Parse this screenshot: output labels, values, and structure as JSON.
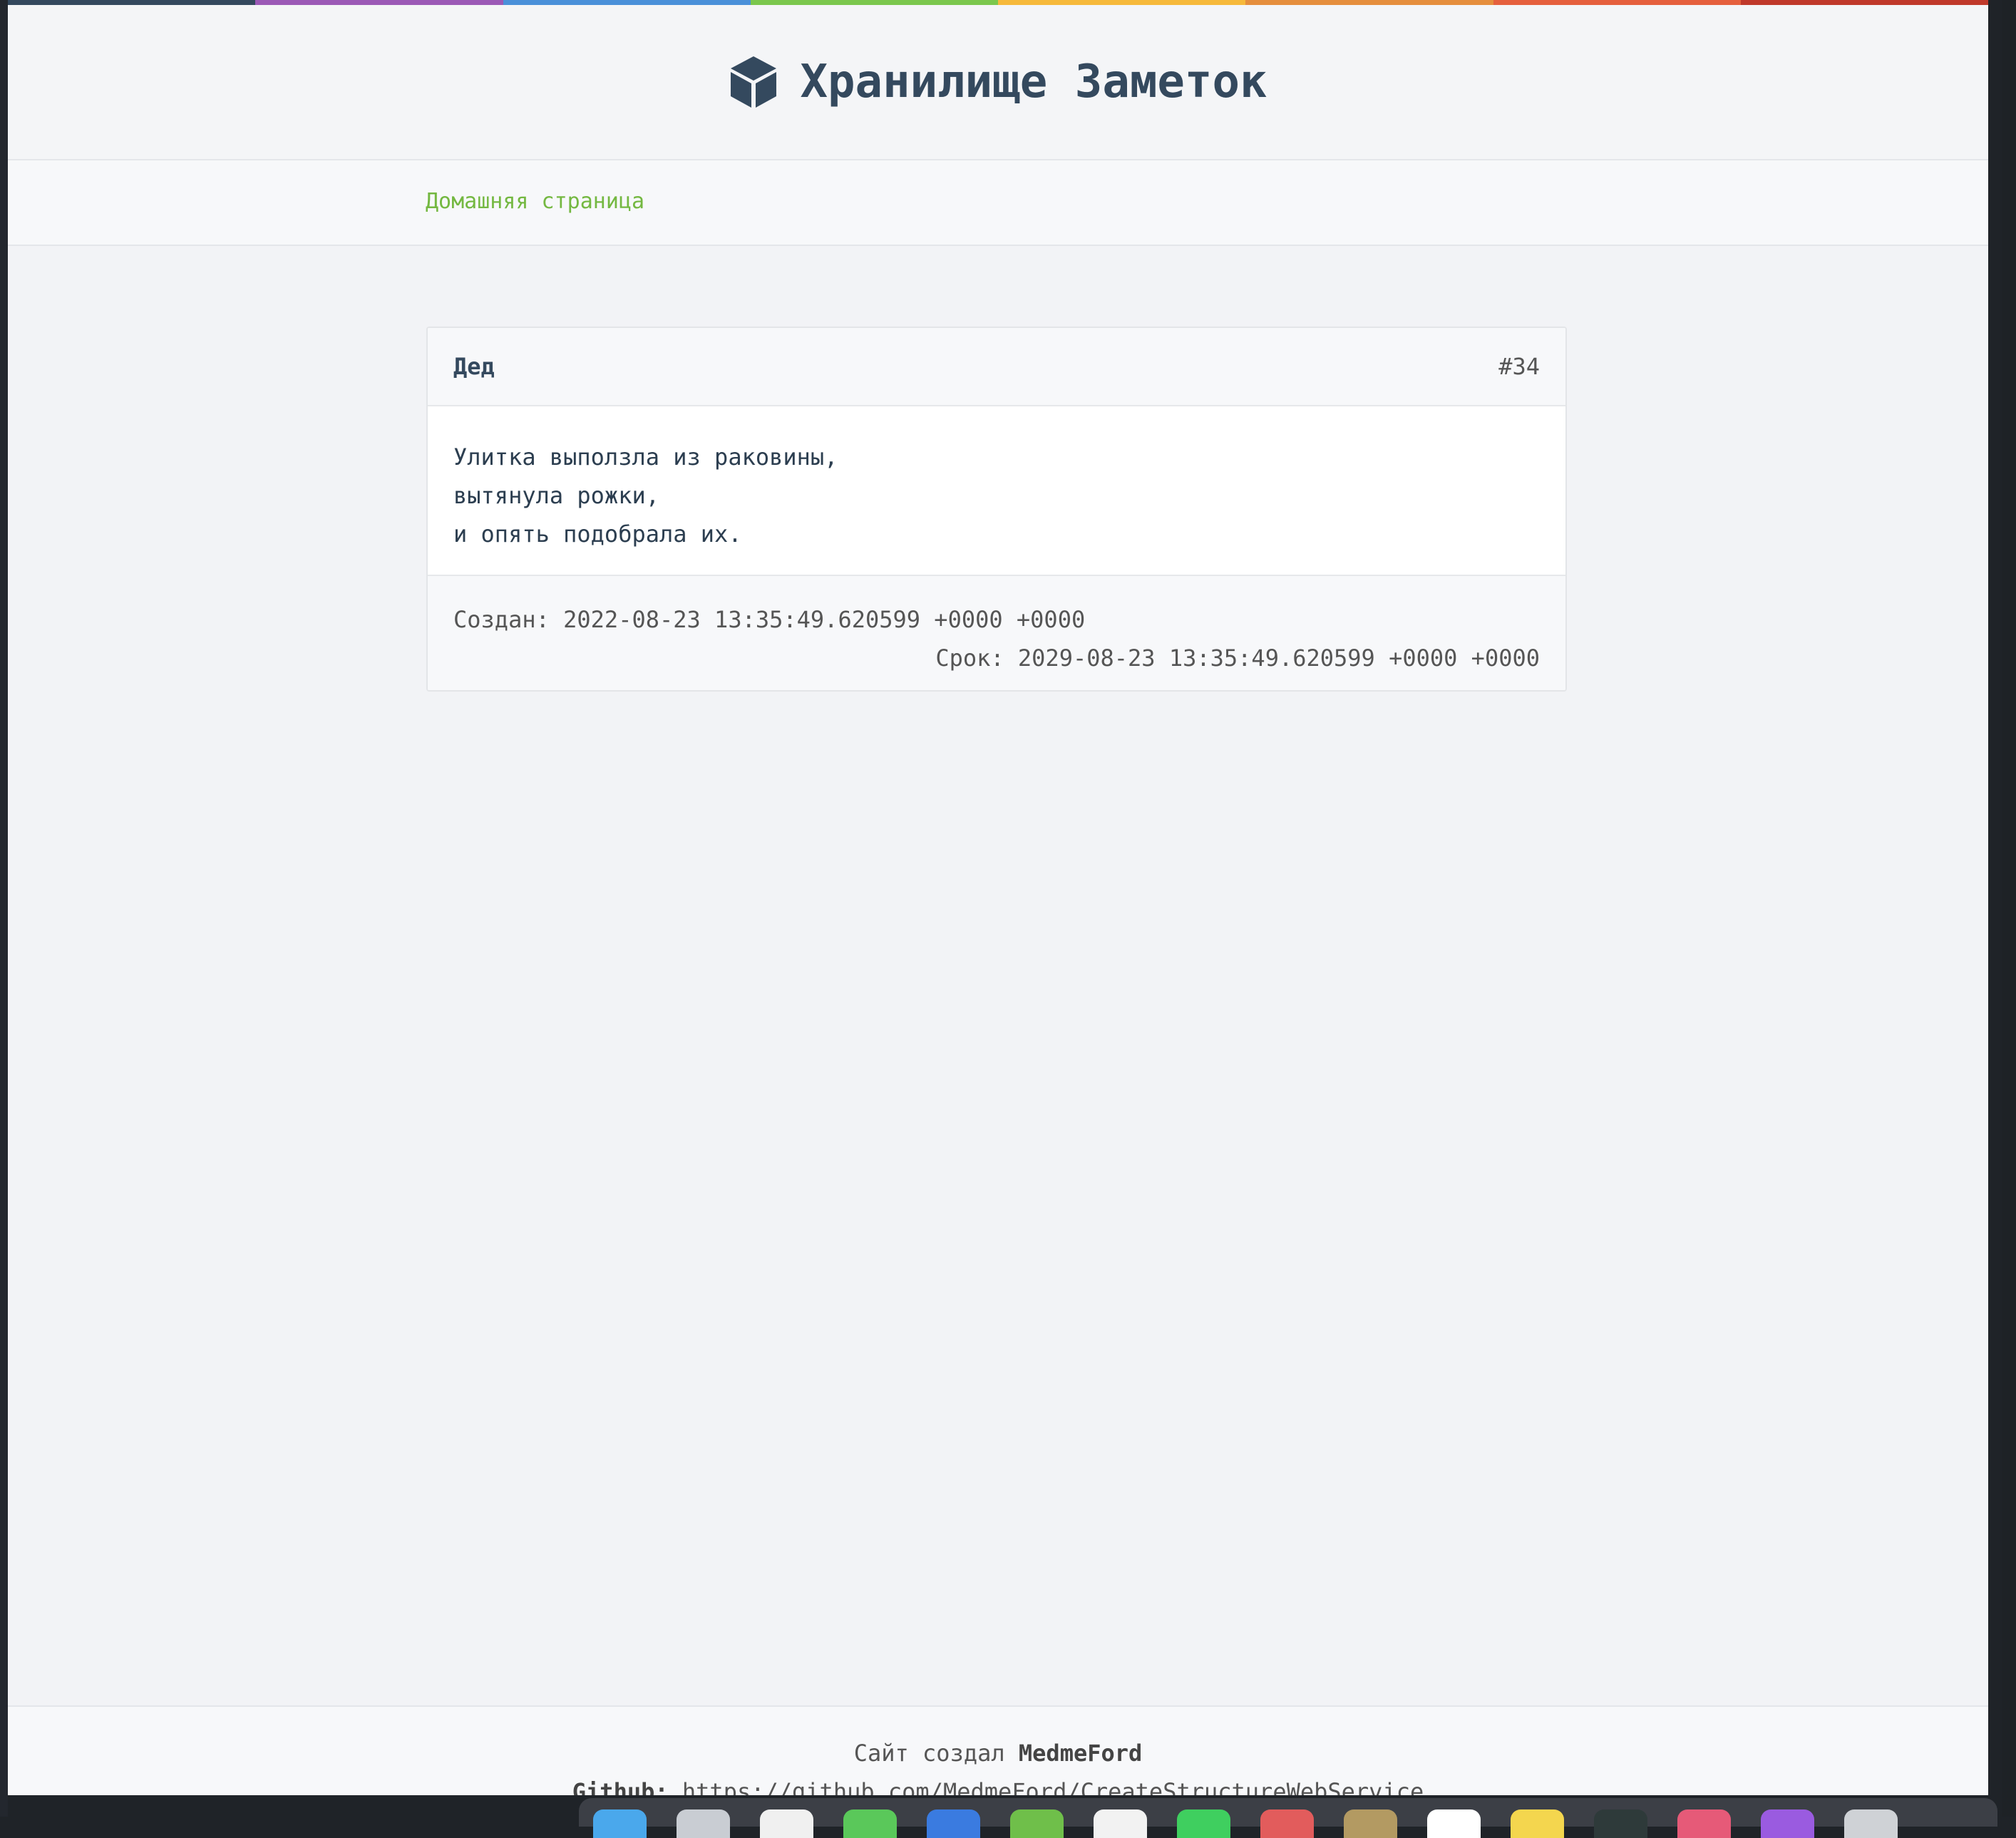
{
  "app": {
    "title": "Хранилище Заметок",
    "icon": "cube-icon",
    "rainbow_colors": [
      "#34495e",
      "#9b59b6",
      "#4a90d9",
      "#7bc74d",
      "#f6b93b",
      "#e58e3d",
      "#e5603d",
      "#c0392b"
    ]
  },
  "nav": {
    "home_label": "Домашняя страница",
    "link_color": "#74b841"
  },
  "note": {
    "author": "Дед",
    "id_label": "#34",
    "body_lines": [
      "Улитка выползла из раковины,",
      "вытянула рожки,",
      "и опять подобрала их."
    ],
    "created_label": "Создан:",
    "created_value": "2022-08-23 13:35:49.620599 +0000 +0000",
    "expires_label": "Срок:",
    "expires_value": "2029-08-23 13:35:49.620599 +0000 +0000"
  },
  "footer": {
    "made_by_prefix": "Сайт создал",
    "made_by_name": "MedmeFord",
    "github_label": "Github:",
    "github_url": "https://github.com/MedmeFord/CreateStructureWebService"
  },
  "dock": {
    "app_colors": [
      "#4aa8ec",
      "#c9cdd3",
      "#f0f0f0",
      "#5ac85a",
      "#3a7be0",
      "#6fbf4a",
      "#f2f2f2",
      "#3fcf5f",
      "#e25c5c",
      "#b39a62",
      "#ffffff",
      "#f4d64e",
      "#2e3a3a",
      "#e65a78",
      "#9a5be0",
      "#cfd2d6"
    ]
  }
}
